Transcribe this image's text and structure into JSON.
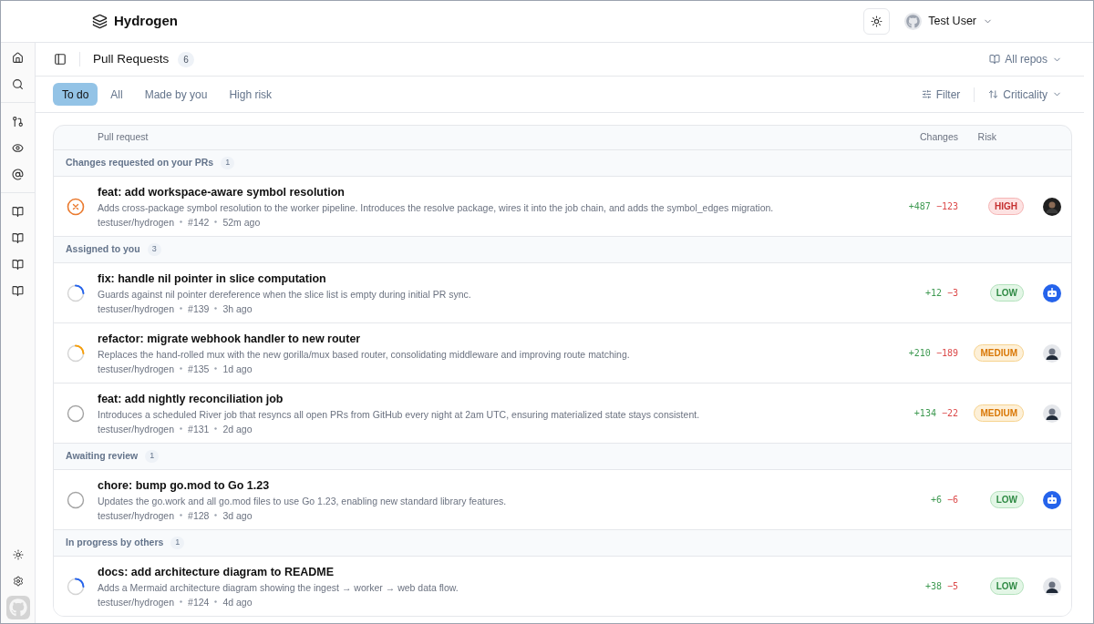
{
  "app": {
    "name": "Hydrogen"
  },
  "user": {
    "name": "Test User"
  },
  "header": {
    "title": "Pull Requests",
    "count": "6",
    "repo_filter": "All repos"
  },
  "tabs": [
    {
      "label": "To do",
      "selected": true
    },
    {
      "label": "All",
      "selected": false
    },
    {
      "label": "Made by you",
      "selected": false
    },
    {
      "label": "High risk",
      "selected": false
    }
  ],
  "toolbar": {
    "filter": "Filter",
    "sort": "Criticality"
  },
  "table": {
    "columns": [
      "Pull request",
      "Changes",
      "Risk"
    ],
    "groups": [
      {
        "title": "Changes requested on your PRs",
        "count": "1",
        "rows": [
          {
            "status": {
              "kind": "rejected",
              "color": "#ea7a2f"
            },
            "title": "feat: add workspace-aware symbol resolution",
            "description": "Adds cross-package symbol resolution to the worker pipeline. Introduces the resolve package, wires it into the job chain, and adds the symbol_edges migration.",
            "repo": "testuser/hydrogen",
            "number": "#142",
            "age": "52m ago",
            "additions": "+487",
            "deletions": "−123",
            "risk": {
              "text": "HIGH",
              "kind": "high"
            },
            "avatar": {
              "kind": "person-dark"
            }
          }
        ]
      },
      {
        "title": "Assigned to you",
        "count": "3",
        "rows": [
          {
            "status": {
              "kind": "partial",
              "color": "#2563eb"
            },
            "title": "fix: handle nil pointer in slice computation",
            "description": "Guards against nil pointer dereference when the slice list is empty during initial PR sync.",
            "repo": "testuser/hydrogen",
            "number": "#139",
            "age": "3h ago",
            "additions": "+12",
            "deletions": "−3",
            "risk": {
              "text": "LOW",
              "kind": "low"
            },
            "avatar": {
              "kind": "bot"
            }
          },
          {
            "status": {
              "kind": "partial",
              "color": "#f59e0b"
            },
            "title": "refactor: migrate webhook handler to new router",
            "description": "Replaces the hand-rolled mux with the new gorilla/mux based router, consolidating middleware and improving route matching.",
            "repo": "testuser/hydrogen",
            "number": "#135",
            "age": "1d ago",
            "additions": "+210",
            "deletions": "−189",
            "risk": {
              "text": "MEDIUM",
              "kind": "medium"
            },
            "avatar": {
              "kind": "person-light"
            }
          },
          {
            "status": {
              "kind": "empty",
              "color": "#a3a3a3"
            },
            "title": "feat: add nightly reconciliation job",
            "description": "Introduces a scheduled River job that resyncs all open PRs from GitHub every night at 2am UTC, ensuring materialized state stays consistent.",
            "repo": "testuser/hydrogen",
            "number": "#131",
            "age": "2d ago",
            "additions": "+134",
            "deletions": "−22",
            "risk": {
              "text": "MEDIUM",
              "kind": "medium"
            },
            "avatar": {
              "kind": "person-light"
            }
          }
        ]
      },
      {
        "title": "Awaiting review",
        "count": "1",
        "rows": [
          {
            "status": {
              "kind": "empty",
              "color": "#a3a3a3"
            },
            "title": "chore: bump go.mod to Go 1.23",
            "description": "Updates the go.work and all go.mod files to use Go 1.23, enabling new standard library features.",
            "repo": "testuser/hydrogen",
            "number": "#128",
            "age": "3d ago",
            "additions": "+6",
            "deletions": "−6",
            "risk": {
              "text": "LOW",
              "kind": "low"
            },
            "avatar": {
              "kind": "bot"
            }
          }
        ]
      },
      {
        "title": "In progress by others",
        "count": "1",
        "rows": [
          {
            "status": {
              "kind": "partial",
              "color": "#2563eb"
            },
            "title": "docs: add architecture diagram to README",
            "description": "Adds a Mermaid architecture diagram showing the ingest → worker → web data flow.",
            "repo": "testuser/hydrogen",
            "number": "#124",
            "age": "4d ago",
            "additions": "+38",
            "deletions": "−5",
            "risk": {
              "text": "LOW",
              "kind": "low"
            },
            "avatar": {
              "kind": "person-light"
            }
          }
        ]
      }
    ]
  }
}
